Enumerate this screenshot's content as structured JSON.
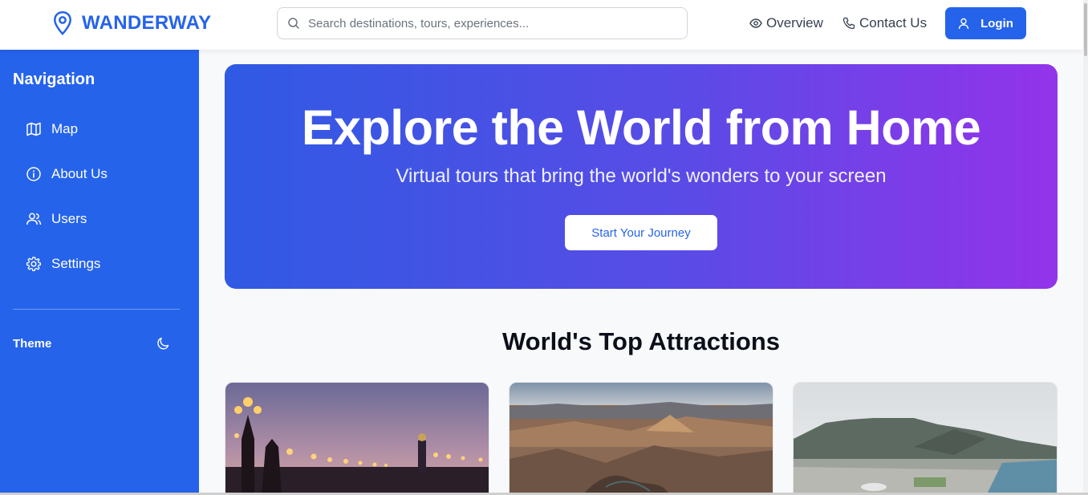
{
  "header": {
    "logo_text": "WANDERWAY",
    "search_placeholder": "Search destinations, tours, experiences...",
    "nav": [
      {
        "label": "Overview",
        "icon": "eye-icon"
      },
      {
        "label": "Contact Us",
        "icon": "phone-icon"
      }
    ],
    "login_label": "Login"
  },
  "sidebar": {
    "title": "Navigation",
    "items": [
      {
        "label": "Map",
        "icon": "map-icon"
      },
      {
        "label": "About Us",
        "icon": "info-icon"
      },
      {
        "label": "Users",
        "icon": "users-icon"
      },
      {
        "label": "Settings",
        "icon": "gear-icon"
      }
    ],
    "theme_label": "Theme",
    "theme_icon": "moon-icon"
  },
  "hero": {
    "title": "Explore the World from Home",
    "subtitle": "Virtual tours that bring the world's wonders to your screen",
    "cta_label": "Start Your Journey"
  },
  "attractions": {
    "title": "World's Top Attractions",
    "cards": [
      {
        "image": "paris-bridge-lamps-photo"
      },
      {
        "image": "grand-canyon-photo"
      },
      {
        "image": "cape-town-table-mountain-photo"
      }
    ]
  },
  "colors": {
    "brand": "#2563eb",
    "hero_gradient_start": "#2f5ae3",
    "hero_gradient_end": "#9333ea"
  }
}
